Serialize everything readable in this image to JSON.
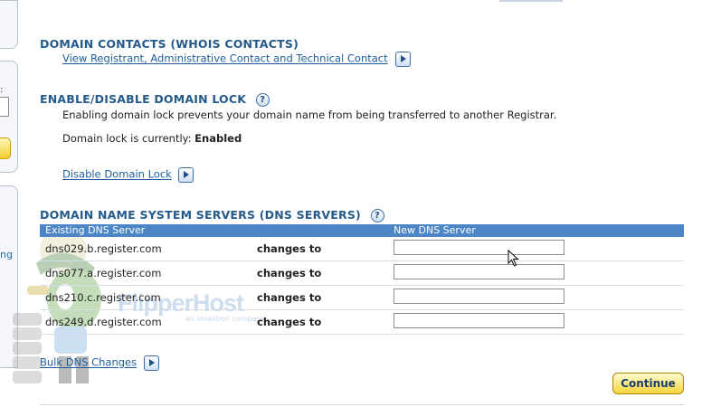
{
  "sidebar": {
    "partial_link": "ng",
    "partial_colon": ":"
  },
  "watermark": {
    "brand": "FlipperHost",
    "tagline": "an investion company"
  },
  "domain_contacts": {
    "title": "DOMAIN CONTACTS (WHOIS CONTACTS)",
    "link": "View Registrant, Administrative Contact and Technical Contact"
  },
  "domain_lock": {
    "title": "ENABLE/DISABLE DOMAIN LOCK",
    "help": "?",
    "description": "Enabling domain lock prevents your domain name from being transferred to another Registrar.",
    "status_label": "Domain lock is currently:",
    "status_value": "Enabled",
    "link": "Disable Domain Lock"
  },
  "dns": {
    "title": "DOMAIN NAME SYSTEM SERVERS (DNS SERVERS)",
    "help": "?",
    "col_existing": "Existing DNS Server",
    "col_new": "New DNS Server",
    "rows": [
      {
        "server": "dns029.b.register.com",
        "changes": "changes to",
        "new_value": ""
      },
      {
        "server": "dns077.a.register.com",
        "changes": "changes to",
        "new_value": ""
      },
      {
        "server": "dns210.c.register.com",
        "changes": "changes to",
        "new_value": ""
      },
      {
        "server": "dns249.d.register.com",
        "changes": "changes to",
        "new_value": ""
      }
    ],
    "bulk_link": "Bulk DNS Changes"
  },
  "continue_label": "Continue"
}
